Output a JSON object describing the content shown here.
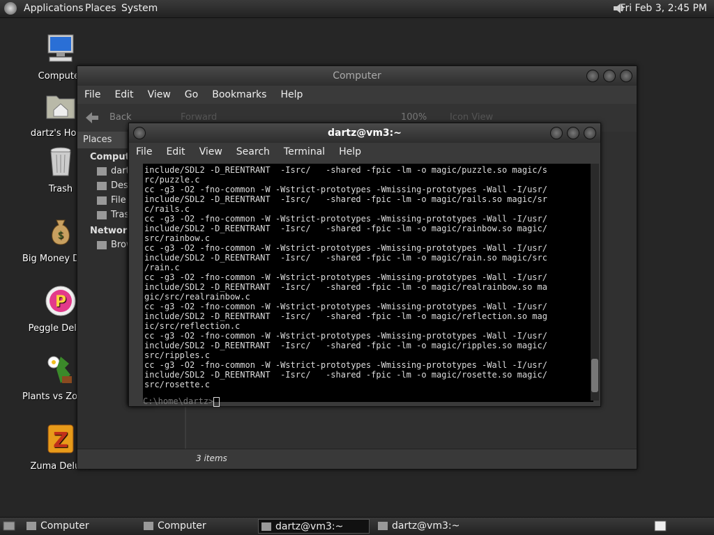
{
  "top_panel": {
    "menus": [
      "Applications",
      "Places",
      "System"
    ],
    "clock": "Fri Feb  3,  2:45 PM"
  },
  "desktop": {
    "icons": [
      "Computer",
      "dartz's Home",
      "Trash",
      "Big Money Deluxe",
      "Peggle Deluxe",
      "Plants vs Zombies",
      "Zuma Deluxe"
    ]
  },
  "nautilus": {
    "title": "Computer",
    "menu": [
      "File",
      "Edit",
      "View",
      "Go",
      "Bookmarks",
      "Help"
    ],
    "toolbar": {
      "back": "Back",
      "forward": "Forward",
      "zoom": "100%",
      "view": "Icon View"
    },
    "sidebar_header": "Places",
    "sidebar": {
      "computer_header": "Computer",
      "items": [
        "dartz",
        "Desktop",
        "File System",
        "Trash"
      ],
      "network_header": "Network",
      "network_items": [
        "Browse Network"
      ]
    },
    "status": "3 items"
  },
  "terminal": {
    "title": "dartz@vm3:~",
    "menu": [
      "File",
      "Edit",
      "View",
      "Search",
      "Terminal",
      "Help"
    ],
    "lines": [
      "include/SDL2 -D_REENTRANT  -Isrc/   -shared -fpic -lm -o magic/puzzle.so magic/s",
      "rc/puzzle.c",
      "cc -g3 -O2 -fno-common -W -Wstrict-prototypes -Wmissing-prototypes -Wall -I/usr/",
      "include/SDL2 -D_REENTRANT  -Isrc/   -shared -fpic -lm -o magic/rails.so magic/sr",
      "c/rails.c",
      "cc -g3 -O2 -fno-common -W -Wstrict-prototypes -Wmissing-prototypes -Wall -I/usr/",
      "include/SDL2 -D_REENTRANT  -Isrc/   -shared -fpic -lm -o magic/rainbow.so magic/",
      "src/rainbow.c",
      "cc -g3 -O2 -fno-common -W -Wstrict-prototypes -Wmissing-prototypes -Wall -I/usr/",
      "include/SDL2 -D_REENTRANT  -Isrc/   -shared -fpic -lm -o magic/rain.so magic/src",
      "/rain.c",
      "cc -g3 -O2 -fno-common -W -Wstrict-prototypes -Wmissing-prototypes -Wall -I/usr/",
      "include/SDL2 -D_REENTRANT  -Isrc/   -shared -fpic -lm -o magic/realrainbow.so ma",
      "gic/src/realrainbow.c",
      "cc -g3 -O2 -fno-common -W -Wstrict-prototypes -Wmissing-prototypes -Wall -I/usr/",
      "include/SDL2 -D_REENTRANT  -Isrc/   -shared -fpic -lm -o magic/reflection.so mag",
      "ic/src/reflection.c",
      "cc -g3 -O2 -fno-common -W -Wstrict-prototypes -Wmissing-prototypes -Wall -I/usr/",
      "include/SDL2 -D_REENTRANT  -Isrc/   -shared -fpic -lm -o magic/ripples.so magic/",
      "src/ripples.c",
      "cc -g3 -O2 -fno-common -W -Wstrict-prototypes -Wmissing-prototypes -Wall -I/usr/",
      "include/SDL2 -D_REENTRANT  -Isrc/   -shared -fpic -lm -o magic/rosette.so magic/",
      "src/rosette.c"
    ],
    "prompt_behind": "C:\\home\\dartz>"
  },
  "taskbar": {
    "tasks": [
      "Computer",
      "Computer",
      "dartz@vm3:~",
      "dartz@vm3:~"
    ]
  },
  "colors": {
    "terminal_bg": "#000000",
    "panel_bg": "#2a2a2a",
    "desktop_bg": "#262626"
  }
}
